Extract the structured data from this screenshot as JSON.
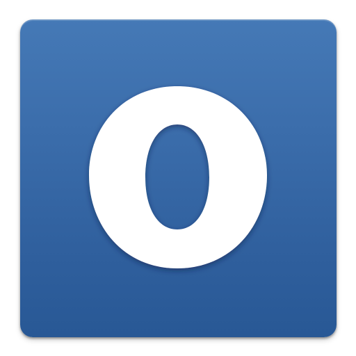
{
  "icon": {
    "name": "letter-o-app-icon",
    "glyph": "O",
    "colors": {
      "background_top": "#4579b6",
      "background_bottom": "#285895",
      "glyph": "#ffffff"
    }
  }
}
